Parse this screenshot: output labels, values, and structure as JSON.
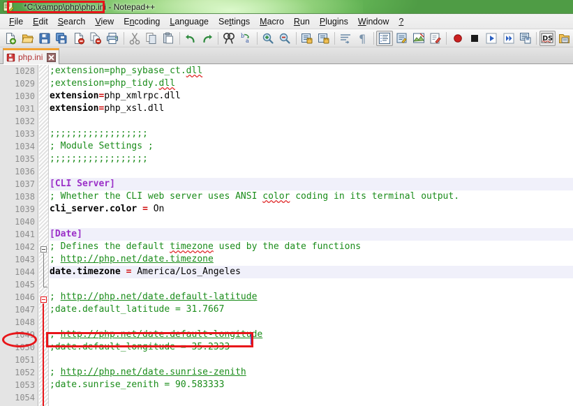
{
  "window": {
    "title_modified_path": "*C:\\xampp\\php\\php.ini",
    "title_suffix": " - Notepad++",
    "app_icon": "notepad-plus-plus-icon"
  },
  "menu": {
    "items": [
      {
        "label": "File",
        "mnemonic": "F"
      },
      {
        "label": "Edit",
        "mnemonic": "E"
      },
      {
        "label": "Search",
        "mnemonic": "S"
      },
      {
        "label": "View",
        "mnemonic": "V"
      },
      {
        "label": "Encoding",
        "mnemonic": "n"
      },
      {
        "label": "Language",
        "mnemonic": "L"
      },
      {
        "label": "Settings",
        "mnemonic": "t"
      },
      {
        "label": "Macro",
        "mnemonic": "M"
      },
      {
        "label": "Run",
        "mnemonic": "R"
      },
      {
        "label": "Plugins",
        "mnemonic": "P"
      },
      {
        "label": "Window",
        "mnemonic": "W"
      },
      {
        "label": "?",
        "mnemonic": ""
      }
    ]
  },
  "toolbar": {
    "groups": [
      [
        "new-file-icon",
        "open-file-icon",
        "save-icon",
        "save-all-icon",
        "close-file-icon",
        "close-all-files-icon",
        "print-icon"
      ],
      [
        "cut-icon",
        "copy-icon",
        "paste-icon"
      ],
      [
        "undo-icon",
        "redo-icon"
      ],
      [
        "find-icon",
        "replace-icon"
      ],
      [
        "zoom-in-icon",
        "zoom-out-icon"
      ],
      [
        "sync-vertical-scroll-icon",
        "sync-horizontal-scroll-icon"
      ],
      [
        "word-wrap-icon",
        "show-all-characters-icon"
      ],
      [
        "show-indent-guide-icon",
        "user-defined-language-icon",
        "show-document-map-icon",
        "function-list-icon"
      ],
      [
        "start-record-macro-icon",
        "stop-record-macro-icon",
        "playback-macro-icon",
        "run-macro-multiple-times-icon",
        "save-macro-icon"
      ],
      [
        "ds-plugin-icon",
        "open-folder-as-workspace-icon"
      ]
    ]
  },
  "tabs": [
    {
      "label": "php.ini",
      "icon": "unsaved-document-icon",
      "close_icon": "close-tab-icon",
      "active": true,
      "modified": true
    }
  ],
  "editor": {
    "first_line": 1028,
    "caret": {
      "line": 1044,
      "after_text": "date.timezone = America/Los_Angeles"
    },
    "lines": [
      {
        "n": 1028,
        "tokens": [
          {
            "t": ";extension=php_sybase_ct.",
            "c": "comment"
          },
          {
            "t": "dll",
            "c": "comment squig"
          }
        ]
      },
      {
        "n": 1029,
        "tokens": [
          {
            "t": ";extension=php_tidy.",
            "c": "comment"
          },
          {
            "t": "dll",
            "c": "comment squig"
          }
        ]
      },
      {
        "n": 1030,
        "tokens": [
          {
            "t": "extension",
            "c": "key"
          },
          {
            "t": "=",
            "c": "op"
          },
          {
            "t": "php_xmlrpc.dll",
            "c": "val"
          }
        ]
      },
      {
        "n": 1031,
        "tokens": [
          {
            "t": "extension",
            "c": "key"
          },
          {
            "t": "=",
            "c": "op"
          },
          {
            "t": "php_xsl.dll",
            "c": "val"
          }
        ]
      },
      {
        "n": 1032,
        "tokens": []
      },
      {
        "n": 1033,
        "tokens": [
          {
            "t": ";;;;;;;;;;;;;;;;;;",
            "c": "comment"
          }
        ]
      },
      {
        "n": 1034,
        "tokens": [
          {
            "t": "; Module Settings ;",
            "c": "comment"
          }
        ]
      },
      {
        "n": 1035,
        "tokens": [
          {
            "t": ";;;;;;;;;;;;;;;;;;",
            "c": "comment"
          }
        ]
      },
      {
        "n": 1036,
        "tokens": []
      },
      {
        "n": 1037,
        "tokens": [
          {
            "t": "[CLI Server]",
            "c": "section"
          }
        ],
        "highlight": true,
        "fold": "open"
      },
      {
        "n": 1038,
        "tokens": [
          {
            "t": "; Whether the CLI web server uses ANSI ",
            "c": "comment"
          },
          {
            "t": "color",
            "c": "comment squig"
          },
          {
            "t": " coding in its terminal output.",
            "c": "comment"
          }
        ]
      },
      {
        "n": 1039,
        "tokens": [
          {
            "t": "cli_server.color ",
            "c": "key"
          },
          {
            "t": "=",
            "c": "op"
          },
          {
            "t": " On",
            "c": "val"
          }
        ]
      },
      {
        "n": 1040,
        "tokens": []
      },
      {
        "n": 1041,
        "tokens": [
          {
            "t": "[Date]",
            "c": "section"
          }
        ],
        "highlight": true,
        "fold": "open-annotated"
      },
      {
        "n": 1042,
        "tokens": [
          {
            "t": "; Defines the default ",
            "c": "comment"
          },
          {
            "t": "timezone",
            "c": "comment squig"
          },
          {
            "t": " used by the date functions",
            "c": "comment"
          }
        ]
      },
      {
        "n": 1043,
        "tokens": [
          {
            "t": "; ",
            "c": "comment"
          },
          {
            "t": "http://php.net/date.timezone",
            "c": "link"
          }
        ]
      },
      {
        "n": 1044,
        "tokens": [
          {
            "t": "date.timezone ",
            "c": "key"
          },
          {
            "t": "=",
            "c": "op"
          },
          {
            "t": " America/Los_Angeles",
            "c": "val"
          }
        ],
        "highlight": true,
        "annotated": true
      },
      {
        "n": 1045,
        "tokens": []
      },
      {
        "n": 1046,
        "tokens": [
          {
            "t": "; ",
            "c": "comment"
          },
          {
            "t": "http://php.net/date.default-latitude",
            "c": "link"
          }
        ]
      },
      {
        "n": 1047,
        "tokens": [
          {
            "t": ";date.default_latitude = 31.7667",
            "c": "comment"
          }
        ]
      },
      {
        "n": 1048,
        "tokens": []
      },
      {
        "n": 1049,
        "tokens": [
          {
            "t": "; ",
            "c": "comment"
          },
          {
            "t": "http://php.net/date.default-longitude",
            "c": "link"
          }
        ]
      },
      {
        "n": 1050,
        "tokens": [
          {
            "t": ";date.default_longitude = 35.2333",
            "c": "comment"
          }
        ]
      },
      {
        "n": 1051,
        "tokens": []
      },
      {
        "n": 1052,
        "tokens": [
          {
            "t": "; ",
            "c": "comment"
          },
          {
            "t": "http://php.net/date.sunrise-zenith",
            "c": "link"
          }
        ]
      },
      {
        "n": 1053,
        "tokens": [
          {
            "t": ";date.sunrise_zenith = 90.583333",
            "c": "comment"
          }
        ]
      },
      {
        "n": 1054,
        "tokens": []
      }
    ]
  },
  "annotations": [
    {
      "name": "title-path-highlight",
      "shape": "rect",
      "target": "*C:\\xampp\\php\\php.ini"
    },
    {
      "name": "line-number-1044-highlight",
      "shape": "oval",
      "target": "1044"
    },
    {
      "name": "timezone-setting-highlight",
      "shape": "rect",
      "target": "date.timezone = America/Los_Angeles"
    }
  ],
  "colors": {
    "annotation_red": "#e8161a",
    "comment_green": "#1a8c1a",
    "section_purple": "#9b30c8",
    "operator_red": "#d01010",
    "title_green": "#62b257",
    "tab_active_orange": "#f0a030",
    "current_line_highlight": "#f0f0fa"
  }
}
